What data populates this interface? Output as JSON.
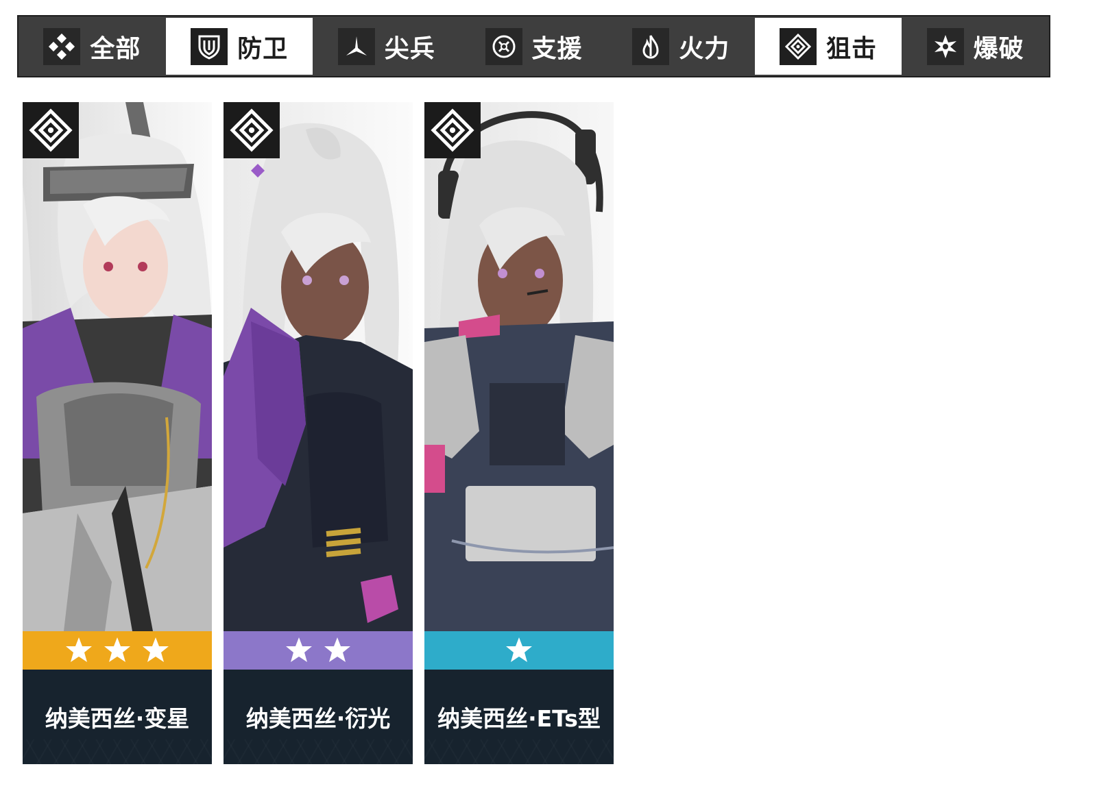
{
  "filter_tabs": [
    {
      "label": "全部",
      "icon": "all-icon",
      "active": false
    },
    {
      "label": "防卫",
      "icon": "defender-icon",
      "active": true
    },
    {
      "label": "尖兵",
      "icon": "vanguard-icon",
      "active": false
    },
    {
      "label": "支援",
      "icon": "support-icon",
      "active": false
    },
    {
      "label": "火力",
      "icon": "firepower-icon",
      "active": false
    },
    {
      "label": "狙击",
      "icon": "sniper-icon",
      "active": true
    },
    {
      "label": "爆破",
      "icon": "demolition-icon",
      "active": false
    }
  ],
  "characters": [
    {
      "name": "纳美西丝·变星",
      "class_icon": "sniper-icon",
      "stars": 3,
      "rarity_color": "#efa81b"
    },
    {
      "name": "纳美西丝·衍光",
      "class_icon": "sniper-icon",
      "stars": 2,
      "rarity_color": "#8c77c9"
    },
    {
      "name": "纳美西丝·ETs型",
      "class_icon": "sniper-icon",
      "stars": 1,
      "rarity_color": "#2eacca"
    }
  ],
  "colors": {
    "bar_bg": "#3e3e3e",
    "active_tab_bg": "#ffffff",
    "name_plate_bg": "#17232e"
  }
}
